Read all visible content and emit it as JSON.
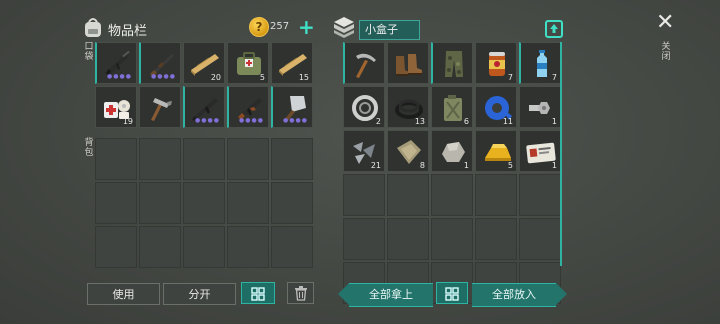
{
  "left_panel": {
    "title": "物品栏",
    "coins": "257",
    "pocket_label": "口袋",
    "backpack_label": "背包"
  },
  "right_panel": {
    "container_name": "小盒子",
    "exit_label": "关闭"
  },
  "pocket_slots": [
    {
      "icon": "assault-rifle-icon",
      "count": "",
      "dots": true
    },
    {
      "icon": "shotgun-icon",
      "count": "",
      "dots": true
    },
    {
      "icon": "wood-plank-icon",
      "count": "20",
      "dots": false
    },
    {
      "icon": "first-aid-bag-icon",
      "count": "5",
      "dots": false
    },
    {
      "icon": "wood-plank-icon",
      "count": "15",
      "dots": false
    },
    {
      "icon": "bandage-kit-icon",
      "count": "19",
      "dots": false
    },
    {
      "icon": "hammer-icon",
      "count": "",
      "dots": false
    },
    {
      "icon": "rifle-icon",
      "count": "",
      "dots": true
    },
    {
      "icon": "ak-rifle-icon",
      "count": "",
      "dots": true
    },
    {
      "icon": "cleaver-icon",
      "count": "",
      "dots": true
    }
  ],
  "box_slots": [
    {
      "icon": "pickaxe-icon",
      "count": ""
    },
    {
      "icon": "boots-icon",
      "count": ""
    },
    {
      "icon": "camo-pants-icon",
      "count": ""
    },
    {
      "icon": "canned-food-icon",
      "count": "7"
    },
    {
      "icon": "water-bottle-icon",
      "count": "7"
    },
    {
      "icon": "bearing-ring-icon",
      "count": "2"
    },
    {
      "icon": "rubber-ring-icon",
      "count": "13"
    },
    {
      "icon": "jerry-can-icon",
      "count": "6"
    },
    {
      "icon": "blue-tape-icon",
      "count": "11"
    },
    {
      "icon": "bolt-nut-icon",
      "count": "1"
    },
    {
      "icon": "metal-scraps-icon",
      "count": "21"
    },
    {
      "icon": "cloth-icon",
      "count": "8"
    },
    {
      "icon": "stone-icon",
      "count": "1"
    },
    {
      "icon": "gold-bar-icon",
      "count": "5"
    },
    {
      "icon": "id-card-icon",
      "count": "1"
    }
  ],
  "buttons": {
    "use": "使用",
    "split": "分开",
    "take_all": "全部拿上",
    "put_all": "全部放入"
  }
}
